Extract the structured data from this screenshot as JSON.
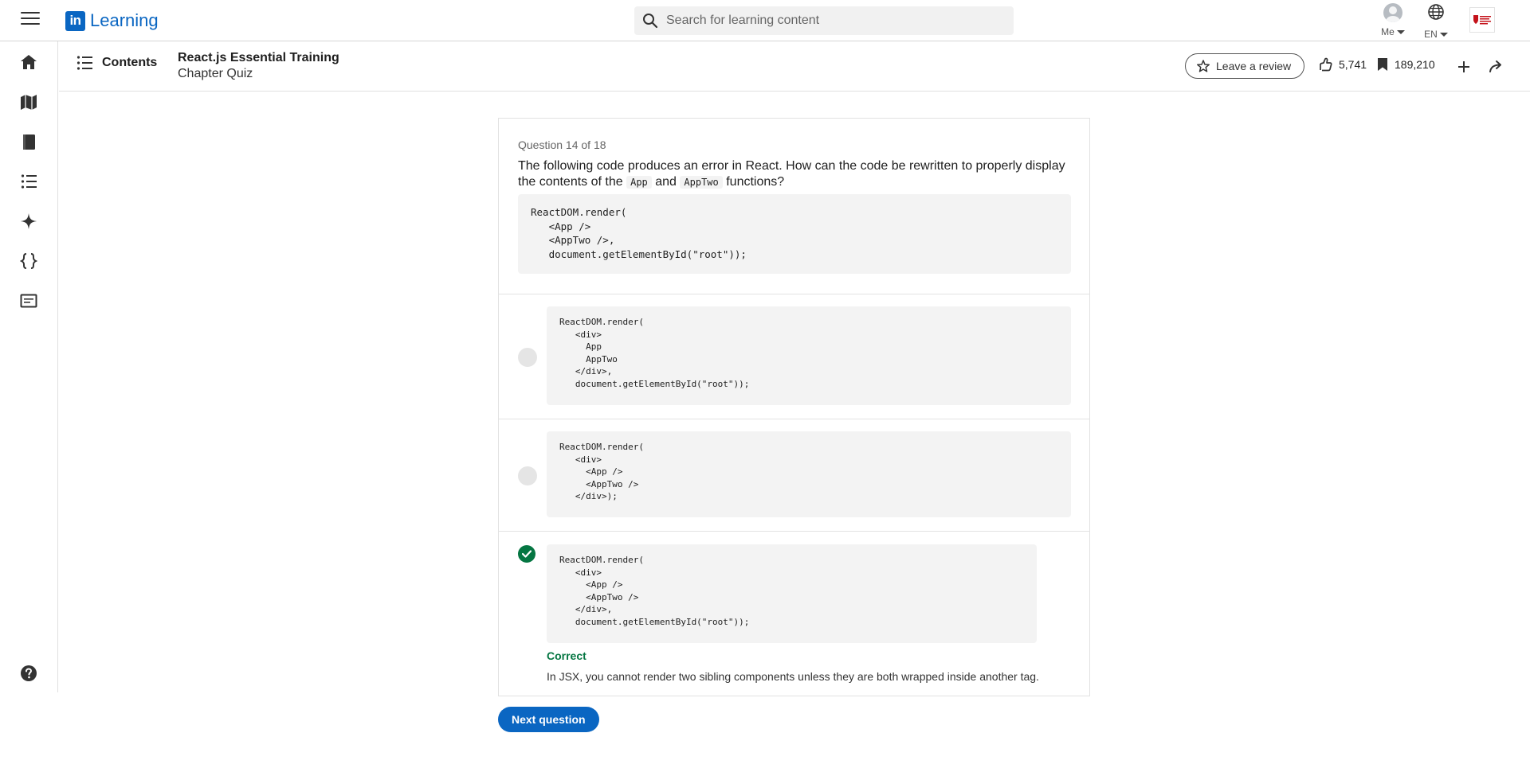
{
  "header": {
    "logo_mark": "in",
    "logo_text": "Learning",
    "search_placeholder": "Search for learning content",
    "me_label": "Me",
    "lang_label": "EN"
  },
  "course": {
    "contents_label": "Contents",
    "title": "React.js Essential Training",
    "subtitle": "Chapter Quiz",
    "review_label": "Leave a review",
    "likes": "5,741",
    "saves": "189,210"
  },
  "quiz": {
    "question_number": "Question 14 of 18",
    "question_part1": "The following code produces an error in React. How can the code be rewritten to properly display the contents of the",
    "code_app": "App",
    "and_word": "and",
    "code_apptwo": "AppTwo",
    "question_part2": "functions?",
    "question_code": "ReactDOM.render(\n   <App />\n   <AppTwo />,\n   document.getElementById(\"root\"));",
    "options": [
      {
        "code": "ReactDOM.render(\n   <div>\n     App\n     AppTwo\n   </div>,\n   document.getElementById(\"root\"));",
        "state": "unselected"
      },
      {
        "code": "ReactDOM.render(\n   <div>\n     <App />\n     <AppTwo />\n   </div>);",
        "state": "unselected"
      },
      {
        "code": "ReactDOM.render(\n   <div>\n     <App />\n     <AppTwo />\n   </div>,\n   document.getElementById(\"root\"));",
        "state": "correct"
      }
    ],
    "feedback_title": "Correct",
    "feedback_text": "In JSX, you cannot render two sibling components unless they are both wrapped inside another tag.",
    "next_label": "Next question"
  },
  "colors": {
    "brand": "#0a66c2",
    "correct": "#057642",
    "code_bg": "#f3f3f3"
  },
  "icons": {
    "rail": [
      "home-icon",
      "map-icon",
      "book-icon",
      "list-icon",
      "sparkle-icon",
      "code-braces-icon",
      "certificate-icon",
      "help-icon"
    ]
  }
}
